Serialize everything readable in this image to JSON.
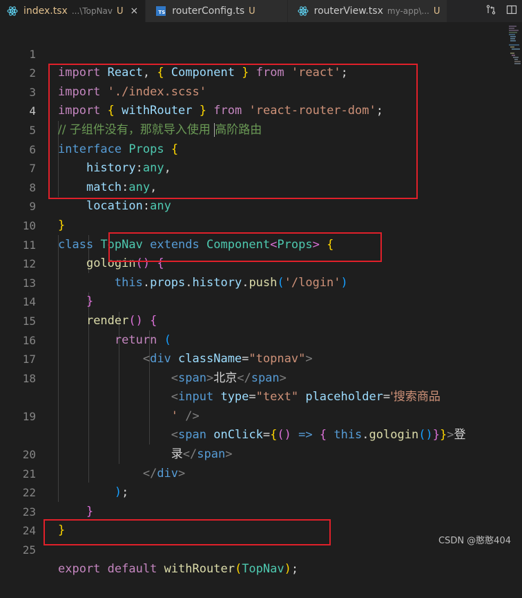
{
  "tabs": [
    {
      "name": "index.tsx",
      "path": "...\\TopNav",
      "status": "U",
      "close": "×",
      "icon": "react-icon",
      "active": true
    },
    {
      "name": "routerConfig.ts",
      "path": "",
      "status": "U",
      "icon": "typescript-icon",
      "badge": "TS",
      "active": false
    },
    {
      "name": "routerView.tsx",
      "path": "my-app\\...",
      "status": "U",
      "icon": "react-icon",
      "active": false
    }
  ],
  "tab_actions": [
    "compare-changes-icon",
    "split-editor-icon"
  ],
  "line_numbers": [
    "1",
    "2",
    "3",
    "4",
    "5",
    "6",
    "7",
    "8",
    "9",
    "10",
    "11",
    "12",
    "13",
    "14",
    "15",
    "16",
    "17",
    "18",
    "",
    "19",
    "",
    "20",
    "21",
    "22",
    "23",
    "24",
    "25"
  ],
  "code": {
    "l1": {
      "import": "import",
      "react": "React",
      "component": "Component",
      "from": "from",
      "module": "'react'"
    },
    "l2": {
      "import": "import",
      "module": "'./index.scss'"
    },
    "l3": {
      "import": "import",
      "withRouter": "withRouter",
      "from": "from",
      "module": "'react-router-dom'"
    },
    "l4": {
      "comment_a": "// 子组件没有，那就导入使用 ",
      "comment_b": "高阶路由"
    },
    "l5": {
      "interface": "interface",
      "name": "Props"
    },
    "l6": {
      "prop": "history",
      "type": "any"
    },
    "l7": {
      "prop": "match",
      "type": "any"
    },
    "l8": {
      "prop": "location",
      "type": "any"
    },
    "l10": {
      "class": "class",
      "name": "TopNav",
      "extends": "extends",
      "base": "Component",
      "generic": "Props"
    },
    "l11": {
      "method": "gologin"
    },
    "l12": {
      "this": "this",
      "props": "props",
      "history": "history",
      "push": "push",
      "arg": "'/login'"
    },
    "l14": {
      "method": "render"
    },
    "l15": {
      "return": "return"
    },
    "l16": {
      "tag": "div",
      "attr": "className",
      "value": "\"topnav\""
    },
    "l17": {
      "tag": "span",
      "text": "北京"
    },
    "l18": {
      "tag": "input",
      "attr1": "type",
      "val1": "\"text\"",
      "attr2": "placeholder",
      "val2a": "'搜索商品",
      "val2b": "'"
    },
    "l19": {
      "tag": "span",
      "attr": "onClick",
      "this": "this",
      "method": "gologin",
      "text_a": "登",
      "text_b": "录"
    },
    "l20": {
      "tag": "div"
    },
    "l25": {
      "export": "export",
      "default": "default",
      "fn": "withRouter",
      "arg": "TopNav"
    }
  },
  "watermark": "CSDN @憨憨404"
}
